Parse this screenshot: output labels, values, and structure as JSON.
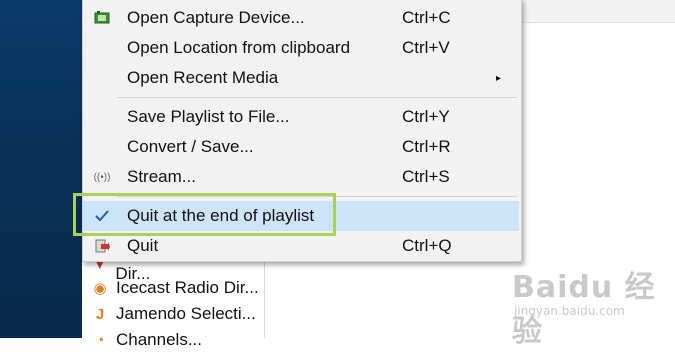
{
  "menu": {
    "items": [
      {
        "label": "Open Capture Device...",
        "shortcut": "Ctrl+C",
        "icon": "capture-device-icon"
      },
      {
        "label": "Open Location from clipboard",
        "shortcut": "Ctrl+V",
        "icon": ""
      },
      {
        "label": "Open Recent Media",
        "shortcut": "",
        "icon": "",
        "submenu_arrow": "▸"
      },
      {
        "label": "Save Playlist to File...",
        "shortcut": "Ctrl+Y",
        "icon": ""
      },
      {
        "label": "Convert / Save...",
        "shortcut": "Ctrl+R",
        "icon": ""
      },
      {
        "label": "Stream...",
        "shortcut": "Ctrl+S",
        "icon": "stream-icon"
      },
      {
        "label": "Quit at the end of playlist",
        "shortcut": "",
        "icon": "checkmark-icon",
        "checked": true
      },
      {
        "label": "Quit",
        "shortcut": "Ctrl+Q",
        "icon": "quit-icon"
      }
    ]
  },
  "sidebar": {
    "items": [
      {
        "label": "Icecast Stream Dir...",
        "icon": "radio-icon"
      },
      {
        "label": "Icecast Radio Dir...",
        "icon": "podcast-icon"
      },
      {
        "label": "Jamendo Selecti...",
        "icon": "jamendo-icon"
      },
      {
        "label": "Channels...",
        "icon": "channels-icon"
      }
    ]
  },
  "watermark": {
    "main": "Baidu 经验",
    "sub": "jingyan.baidu.com"
  },
  "colors": {
    "highlight_border": "#a8d15c",
    "checked_bg": "#cde4f7",
    "menu_bg": "#f2f2f2",
    "check_color": "#1a5fb4"
  }
}
